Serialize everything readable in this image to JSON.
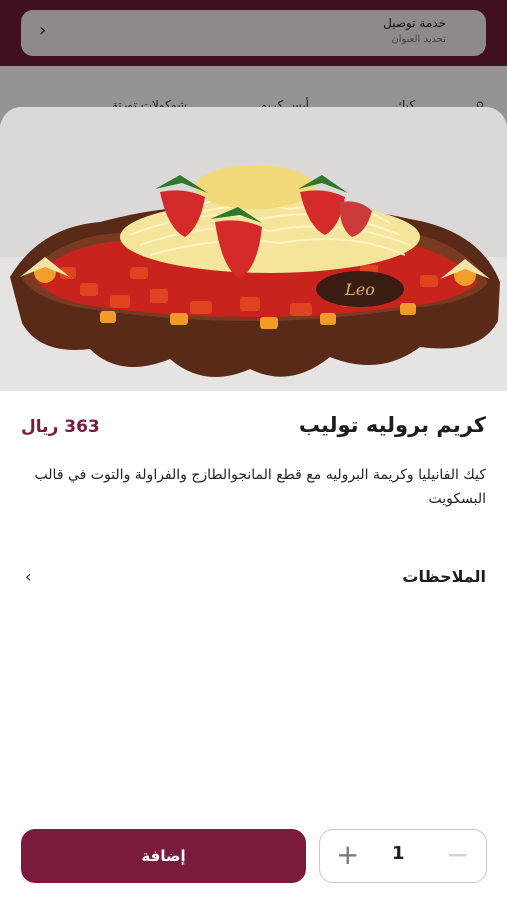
{
  "delivery": {
    "title": "خدمة توصيل",
    "subtitle": "تحديد العنوان"
  },
  "background_tabs": [
    "كيك",
    "أيس كريم",
    "شوكولات تورتة"
  ],
  "product": {
    "name": "كريم بروليه توليب",
    "price": "363 ريال",
    "description": "كيك الفانيليا وكريمة البروليه مع قطع المانجوالطازج والفراولة والتوت في قالب البسكويت",
    "brand_mark": "Leo"
  },
  "notes": {
    "label": "الملاحظات",
    "chevron": "›"
  },
  "actions": {
    "add_label": "إضافة",
    "quantity": "1",
    "plus": "+",
    "minus": "−"
  },
  "colors": {
    "brand": "#7a1b3d",
    "header": "#6e1a38"
  }
}
